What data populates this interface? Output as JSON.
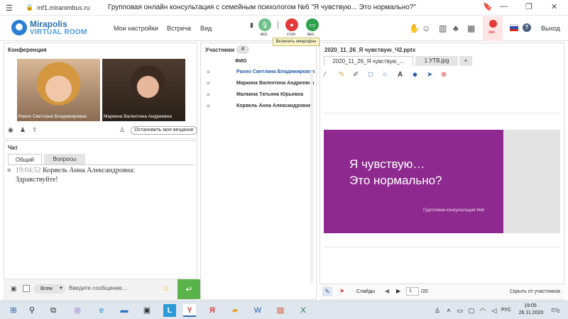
{
  "browser": {
    "url": "mf1.miranimbus.ru",
    "tab_title": "Групповая онлайн консультация с семейным психологом №6 \"Я чувствую... Это нормально?\""
  },
  "header": {
    "logo_line1": "Mirapolis",
    "logo_line2": "VIRTUAL ROOM",
    "nav": [
      "Мои настройки",
      "Встреча",
      "Вид"
    ],
    "mic_label": "вкл.",
    "stop_label": "стоп",
    "video_label": "вкл.",
    "tooltip": "Включить микрофон",
    "rec_label": "rec",
    "help": "?",
    "exit_label": "Выход"
  },
  "conference": {
    "title": "Конференция",
    "participants": [
      "Рахно Светлана  Владимировна",
      "Маркина Валентина  Андреевна"
    ],
    "stop_broadcast_label": "Остановить мое вещание"
  },
  "chat": {
    "title": "Чат",
    "tabs": [
      "Общий",
      "Вопросы"
    ],
    "message": {
      "time": "19:04:52",
      "author": "Корвель Анна  Александровна:",
      "text": "Здравствуйте!"
    },
    "recipient": "Всем",
    "input_placeholder": "Введите сообщение..."
  },
  "participants": {
    "title": "Участники",
    "count": "4",
    "column_header": "ФИО",
    "list": [
      "Рахно Светлана  Владимировна",
      "Маркина Валентина  Андреевна",
      "Малкина Татьяна  Юрьевна",
      "Корвель Анна  Александровна"
    ]
  },
  "presentation": {
    "file_title": "2020_11_26_Я чувствую_Ч2.pptx",
    "tabs": [
      "2020_11_26_Я чувствую_...",
      "1 УТВ.jpg",
      "+"
    ],
    "slide_line1": "Я чувствую…",
    "slide_line2": "Это нормально?",
    "slide_caption": "Групповая консультация №6",
    "slides_label": "Слайды",
    "current_page": "1",
    "total_pages": "/20",
    "hide_participants_label": "Скрыть от участников"
  },
  "taskbar": {
    "language": "РУС",
    "time": "19:05",
    "date": "26.11.2020",
    "notifications": "2"
  },
  "colors": {
    "slide_bg": "#8e2a8f",
    "send_button": "#5ab34a",
    "rec": "#e33a3a",
    "brand": "#2a6ea8"
  }
}
